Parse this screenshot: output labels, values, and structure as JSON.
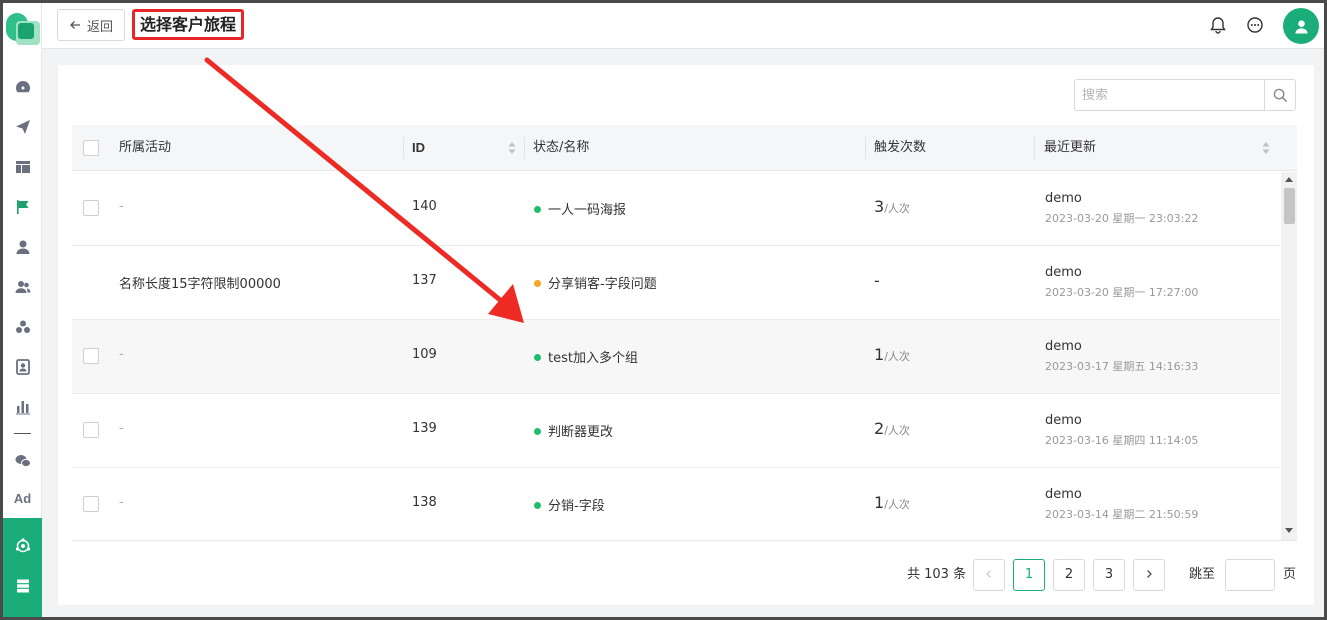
{
  "header": {
    "back_label": "返回",
    "title": "选择客户旅程"
  },
  "search": {
    "placeholder": "搜索"
  },
  "table": {
    "columns": {
      "activity": "所属活动",
      "id": "ID",
      "status_name": "状态/名称",
      "trigger_count": "触发次数",
      "updated": "最近更新"
    },
    "rows": [
      {
        "activity": "-",
        "id": "140",
        "status_color": "#1fbf6a",
        "name": "一人一码海报",
        "count": "3",
        "unit": "/人次",
        "user": "demo",
        "time": "2023-03-20 星期一 23:03:22",
        "checkbox": true
      },
      {
        "activity": "名称长度15字符限制00000",
        "id": "137",
        "status_color": "#f5a623",
        "name": "分享销客-字段问题",
        "count": "-",
        "unit": "",
        "user": "demo",
        "time": "2023-03-20 星期一 17:27:00",
        "checkbox": false
      },
      {
        "activity": "-",
        "id": "109",
        "status_color": "#1fbf6a",
        "name": "test加入多个组",
        "count": "1",
        "unit": "/人次",
        "user": "demo",
        "time": "2023-03-17 星期五 14:16:33",
        "checkbox": true
      },
      {
        "activity": "-",
        "id": "139",
        "status_color": "#1fbf6a",
        "name": "判断器更改",
        "count": "2",
        "unit": "/人次",
        "user": "demo",
        "time": "2023-03-16 星期四 11:14:05",
        "checkbox": true
      },
      {
        "activity": "-",
        "id": "138",
        "status_color": "#1fbf6a",
        "name": "分销-字段",
        "count": "1",
        "unit": "/人次",
        "user": "demo",
        "time": "2023-03-14 星期二 21:50:59",
        "checkbox": true
      }
    ]
  },
  "pagination": {
    "total": "共 103 条",
    "prev": "<",
    "pages": [
      "1",
      "2",
      "3"
    ],
    "next": ">",
    "jump_label": "跳至",
    "page_label": "页"
  },
  "colors": {
    "accent": "#1aad7a",
    "highlight_box": "#e8262a",
    "annotation_arrow": "#ee2a24"
  }
}
